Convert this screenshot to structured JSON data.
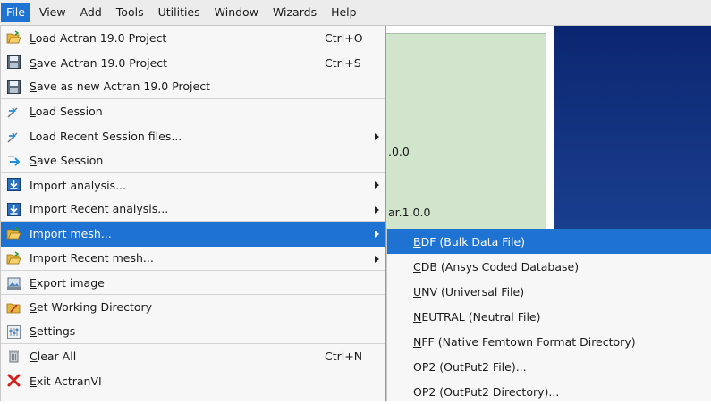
{
  "menubar": {
    "items": [
      {
        "label": "File",
        "active": true
      },
      {
        "label": "View"
      },
      {
        "label": "Add"
      },
      {
        "label": "Tools"
      },
      {
        "label": "Utilities"
      },
      {
        "label": "Window"
      },
      {
        "label": "Wizards"
      },
      {
        "label": "Help"
      }
    ]
  },
  "background": {
    "text_1": ".0.0",
    "text_2": "ar.1.0.0"
  },
  "file_menu": {
    "items": [
      {
        "ul": "L",
        "rest": "oad Actran 19.0 Project",
        "shortcut": "Ctrl+O",
        "icon": "folder-open-icon"
      },
      {
        "ul": "S",
        "rest": "ave Actran 19.0 Project",
        "shortcut": "Ctrl+S",
        "icon": "floppy-disk-icon"
      },
      {
        "ul": "S",
        "rest": "ave as new Actran 19.0 Project",
        "shortcut": "",
        "icon": "floppy-disk-icon"
      },
      {
        "ul": "L",
        "rest": "oad Session",
        "shortcut": "",
        "icon": "session-load-icon"
      },
      {
        "ul": "",
        "rest": "Load Recent Session files...",
        "shortcut": "",
        "icon": "session-load-icon",
        "submenu": true
      },
      {
        "ul": "S",
        "rest": "ave Session",
        "shortcut": "",
        "icon": "session-save-icon"
      },
      {
        "ul": "",
        "rest": "Import analysis...",
        "shortcut": "",
        "icon": "import-analysis-icon",
        "submenu": true
      },
      {
        "ul": "",
        "rest": "Import Recent analysis...",
        "shortcut": "",
        "icon": "import-analysis-icon",
        "submenu": true
      },
      {
        "ul": "",
        "rest": "Import mesh...",
        "shortcut": "",
        "icon": "folder-open-icon",
        "submenu": true,
        "selected": true
      },
      {
        "ul": "",
        "rest": "Import Recent mesh...",
        "shortcut": "",
        "icon": "folder-open-icon",
        "submenu": true
      },
      {
        "ul": "E",
        "rest": "xport image",
        "shortcut": "",
        "icon": "export-image-icon"
      },
      {
        "ul": "S",
        "rest": "et Working Directory",
        "shortcut": "",
        "icon": "working-directory-icon"
      },
      {
        "ul": "S",
        "rest": "ettings",
        "shortcut": "",
        "icon": "settings-icon"
      },
      {
        "ul": "C",
        "rest": "lear All",
        "shortcut": "Ctrl+N",
        "icon": "trash-icon"
      },
      {
        "ul": "E",
        "rest": "xit ActranVI",
        "shortcut": "",
        "icon": "exit-icon"
      }
    ]
  },
  "submenu": {
    "items": [
      {
        "ul": "B",
        "rest": "DF (Bulk Data File)",
        "selected": true
      },
      {
        "ul": "C",
        "rest": "DB (Ansys Coded Database)"
      },
      {
        "ul": "U",
        "rest": "NV (Universal File)"
      },
      {
        "ul": "N",
        "rest": "EUTRAL (Neutral File)"
      },
      {
        "ul": "N",
        "rest": "FF (Native Femtown Format Directory)"
      },
      {
        "ul": "",
        "rest": "OP2 (OutPut2 File)..."
      },
      {
        "ul": "",
        "rest": "OP2 (OutPut2 Directory)..."
      }
    ]
  },
  "colors": {
    "accent": "#1e73d2",
    "menu_bg": "#f7f7f7",
    "viewport_green": "#d1e5cd",
    "viewport_blue": "#0b2670"
  }
}
